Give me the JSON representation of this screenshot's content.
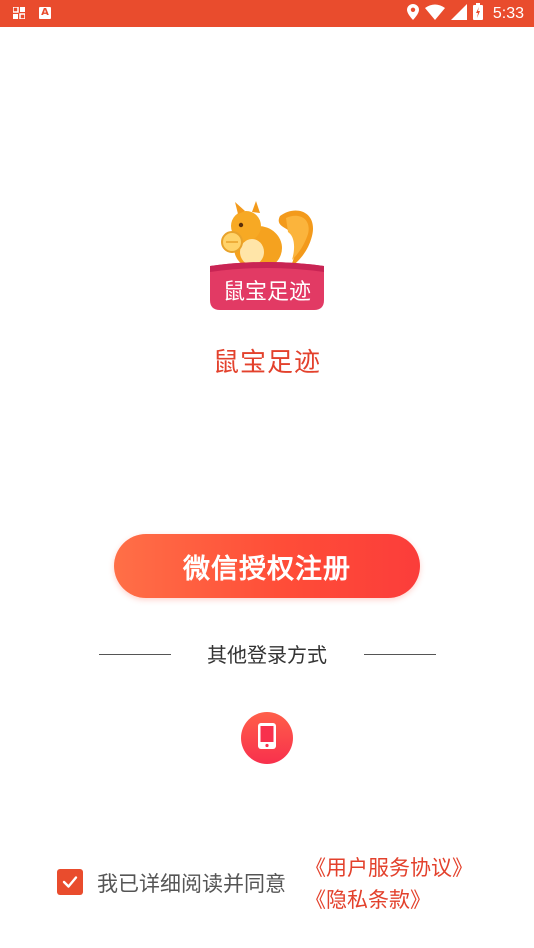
{
  "status_bar": {
    "time": "5:33",
    "left_icons": [
      "grid-icon",
      "a-letter-icon"
    ],
    "left_a_label": "A",
    "right_icons": [
      "location-pin-icon",
      "wifi-icon",
      "signal-icon",
      "battery-icon"
    ]
  },
  "app": {
    "name": "鼠宝足迹",
    "logo_text": "鼠宝足迹",
    "accent_color": "#e94c2d"
  },
  "actions": {
    "wechat_button_label": "微信授权注册",
    "other_login_label": "其他登录方式",
    "phone_login_icon": "phone-icon"
  },
  "agreement": {
    "checked": true,
    "text": "我已详细阅读并同意",
    "terms_link": "《用户服务协议》",
    "privacy_link": "《隐私条款》"
  }
}
